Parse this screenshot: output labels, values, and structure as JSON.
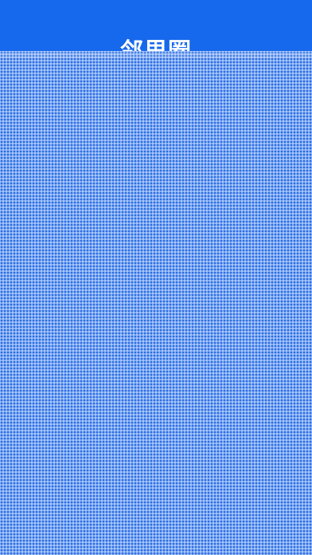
{
  "header": {
    "title": "邻里圈"
  },
  "colors": {
    "primary": "#1668ec",
    "overlay": "#78a6f4"
  }
}
